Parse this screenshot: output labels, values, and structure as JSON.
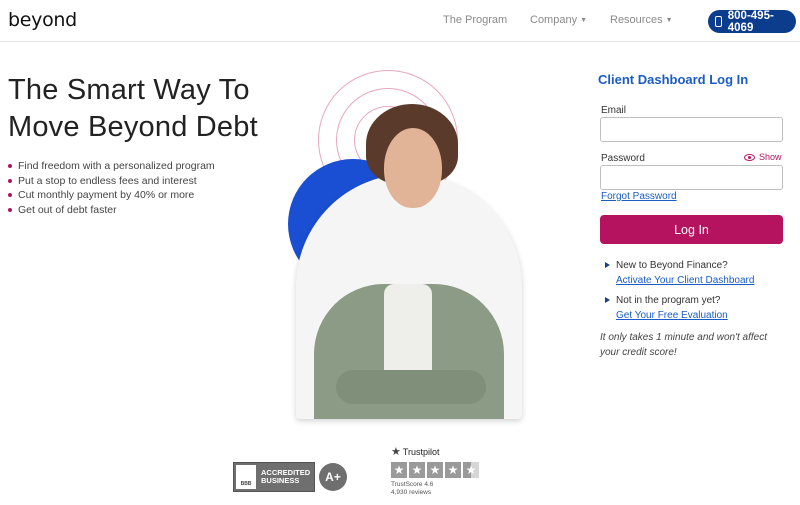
{
  "header": {
    "logo": "beyond",
    "nav": [
      {
        "label": "The Program",
        "has_caret": false
      },
      {
        "label": "Company",
        "has_caret": true
      },
      {
        "label": "Resources",
        "has_caret": true
      }
    ],
    "phone": "800-495-4069"
  },
  "hero": {
    "title_line1": "The Smart Way To",
    "title_line2": "Move Beyond Debt",
    "bullets": [
      "Find freedom with a personalized program",
      "Put a stop to endless fees and interest",
      "Cut monthly payment by 40% or more",
      "Get out of debt faster"
    ]
  },
  "login": {
    "title": "Client Dashboard Log In",
    "email_label": "Email",
    "email_value": "",
    "password_label": "Password",
    "password_value": "",
    "show_label": "Show",
    "forgot_label": "Forgot Password",
    "button_label": "Log In",
    "prompts": [
      {
        "text": "New to Beyond Finance?",
        "link": "Activate Your Client Dashboard"
      },
      {
        "text": "Not in the program yet?",
        "link": "Get Your Free Evaluation"
      }
    ],
    "note": "It only takes 1 minute and won't affect your credit score!"
  },
  "badges": {
    "bbb_logo": "BBB",
    "bbb_line1": "ACCREDITED",
    "bbb_line2": "BUSINESS",
    "bbb_grade": "A+",
    "trustpilot_name": "Trustpilot",
    "trustpilot_rating": 4.6,
    "trustpilot_score": "TrustScore 4.6",
    "trustpilot_reviews": "4,930 reviews"
  },
  "colors": {
    "brand_blue": "#1a5cc4",
    "phone_button": "#0c3c8c",
    "accent_magenta": "#b5135f",
    "hero_circle": "#1b4fd3"
  }
}
